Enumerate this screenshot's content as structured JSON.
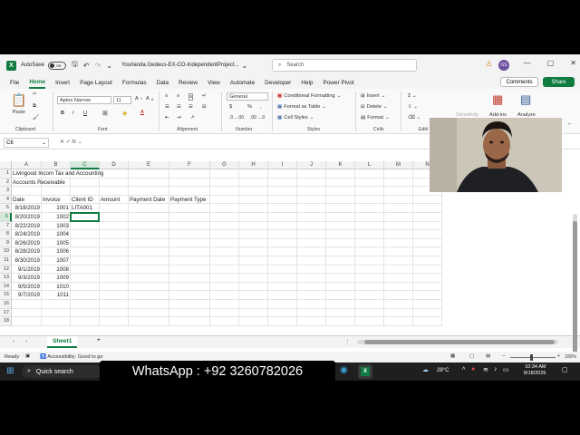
{
  "titlebar": {
    "autosave_label": "AutoSave",
    "autosave_state": "Off",
    "filename": "Yourlanda.Gedeus-EX-CO-IndependentProject...",
    "search_placeholder": "Search",
    "avatar_initials": "GS"
  },
  "menu": {
    "tabs": [
      "File",
      "Home",
      "Insert",
      "Page Layout",
      "Formulas",
      "Data",
      "Review",
      "View",
      "Automate",
      "Developer",
      "Help",
      "Power Pivot"
    ],
    "active": "Home",
    "comments_label": "Comments",
    "share_label": "Share"
  },
  "ribbon": {
    "clipboard": {
      "paste": "Paste",
      "label": "Clipboard"
    },
    "font": {
      "name": "Aptos Narrow",
      "size": "11",
      "label": "Font",
      "bold": "B",
      "italic": "I",
      "underline": "U"
    },
    "alignment": {
      "label": "Alignment"
    },
    "number": {
      "format": "General",
      "label": "Number",
      "currency": "$",
      "percent": "%"
    },
    "styles": {
      "conditional": "Conditional Formatting",
      "table": "Format as Table",
      "cellstyles": "Cell Styles",
      "label": "Styles"
    },
    "cells": {
      "insert": "Insert",
      "delete": "Delete",
      "format": "Format",
      "label": "Cells"
    },
    "editing": {
      "label": "Editi"
    },
    "addins": {
      "sensitivity": "Sensitivity",
      "addins": "Add-ins",
      "analyze": "Analyze"
    }
  },
  "formula_bar": {
    "name_box": "C6",
    "fx": "fx",
    "value": ""
  },
  "columns": [
    "A",
    "B",
    "C",
    "D",
    "E",
    "F",
    "G",
    "H",
    "I",
    "J",
    "K",
    "L",
    "M",
    "N"
  ],
  "rows": [
    "1",
    "2",
    "3",
    "4",
    "5",
    "6",
    "7",
    "8",
    "9",
    "10",
    "11",
    "12",
    "13",
    "14",
    "15",
    "16",
    "17",
    "18"
  ],
  "cells": {
    "A1": "Livingood Incom Tax and Accounting",
    "A2": "Accounts Receivable",
    "A4": "Date",
    "B4": "Invoice",
    "C4": "Client ID",
    "D4": "Amount",
    "E4": "Payment Date",
    "F4": "Payment Type",
    "A5": "8/18/2019",
    "B5": "1001",
    "C5": "LITA001",
    "A6": "8/20/2019",
    "B6": "1002",
    "A7": "8/22/2019",
    "B7": "1003",
    "A8": "8/24/2019",
    "B8": "1004",
    "A9": "8/26/2019",
    "B9": "1005",
    "A10": "8/28/2019",
    "B10": "1006",
    "A11": "8/30/2019",
    "B11": "1007",
    "A12": "9/1/2019",
    "B12": "1008",
    "A13": "9/3/2019",
    "B13": "1009",
    "A14": "9/5/2019",
    "B14": "1010",
    "A15": "9/7/2019",
    "B15": "1011"
  },
  "sheets": {
    "tabs": [
      "Sheet1"
    ],
    "add": "+"
  },
  "status": {
    "ready": "Ready",
    "accessibility": "Accessibility: Good to go",
    "zoom": "100%"
  },
  "taskbar": {
    "search": "Quick search",
    "weather": "28°C",
    "time": "10:34 AM",
    "date": "8/18/2025"
  },
  "overlay": {
    "banner": "WhatsApp : +92 3260782026"
  },
  "colors": {
    "excel_green": "#107c41",
    "taskbar": "#1f1f1f"
  }
}
